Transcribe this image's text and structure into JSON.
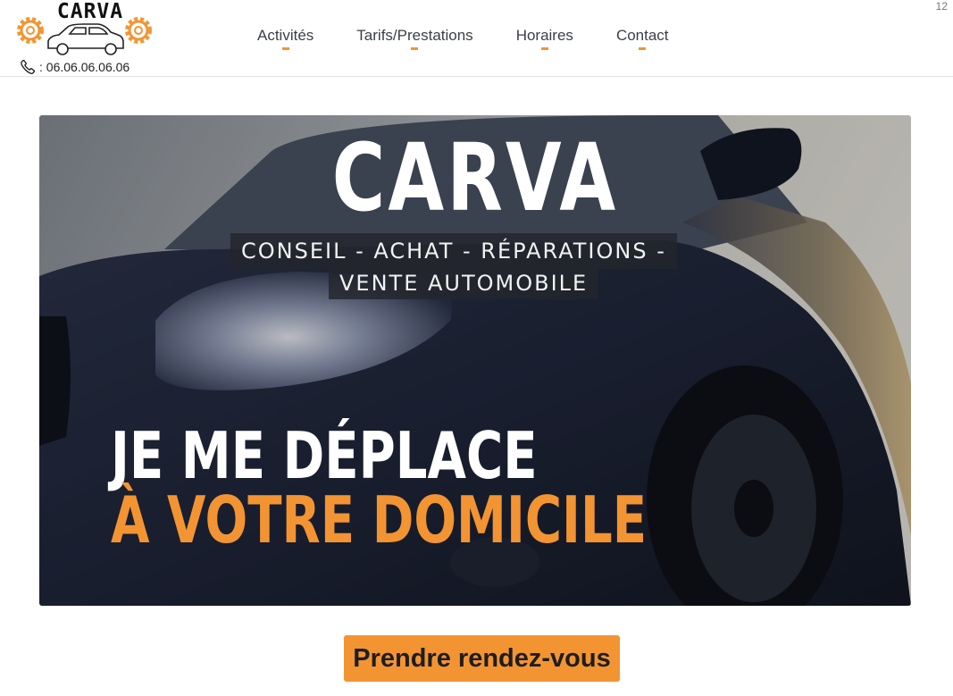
{
  "logo": {
    "text": "CARVA"
  },
  "phone": {
    "icon": "phone-icon",
    "text": ": 06.06.06.06.06"
  },
  "page_number": "12",
  "nav": {
    "items": [
      {
        "label": "Activités"
      },
      {
        "label": "Tarifs/Prestations"
      },
      {
        "label": "Horaires"
      },
      {
        "label": "Contact"
      }
    ]
  },
  "hero": {
    "title": "CARVA",
    "tagline_line1": "CONSEIL - ACHAT - RÉPARATIONS -",
    "tagline_line2": "VENTE AUTOMOBILE",
    "headline_line1": "JE ME DÉPLACE",
    "headline_line2": "À VOTRE DOMICILE"
  },
  "cta": {
    "label": "Prendre rendez-vous"
  },
  "colors": {
    "accent": "#f39433",
    "text": "#3b4048"
  }
}
